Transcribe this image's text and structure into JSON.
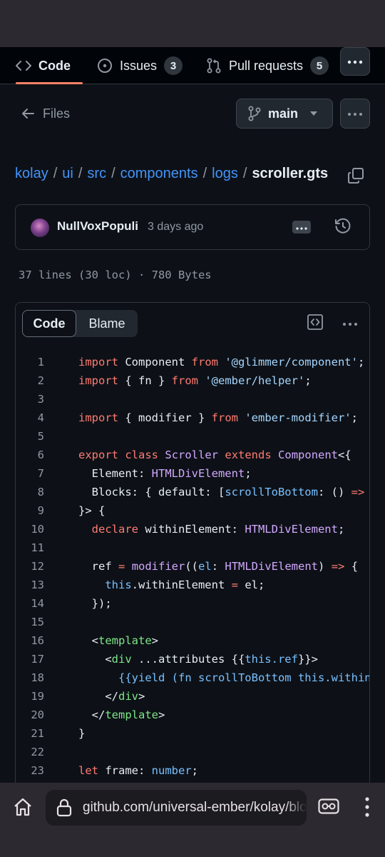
{
  "repo_tabs": {
    "code_label": "Code",
    "issues_label": "Issues",
    "issues_count": "3",
    "pulls_label": "Pull requests",
    "pulls_count": "5"
  },
  "nav": {
    "files_label": "Files",
    "branch": "main"
  },
  "breadcrumb": {
    "parts": [
      "kolay",
      "ui",
      "src",
      "components",
      "logs"
    ],
    "separator": "/",
    "current": "scroller.gts"
  },
  "commit": {
    "author": "NullVoxPopuli",
    "time": "3 days ago"
  },
  "file_stats": "37 lines (30 loc) · 780 Bytes",
  "code_view": {
    "code_tab": "Code",
    "blame_tab": "Blame"
  },
  "code": {
    "line_numbers": [
      "1",
      "2",
      "3",
      "4",
      "5",
      "6",
      "7",
      "8",
      "9",
      "10",
      "11",
      "12",
      "13",
      "14",
      "15",
      "16",
      "17",
      "18",
      "19",
      "20",
      "21",
      "22",
      "23"
    ],
    "lines": [
      [
        [
          "kw",
          "import"
        ],
        [
          "p",
          " Component "
        ],
        [
          "kw",
          "from"
        ],
        [
          "p",
          " "
        ],
        [
          "str",
          "'@glimmer/component'"
        ],
        [
          "p",
          ";"
        ]
      ],
      [
        [
          "kw",
          "import"
        ],
        [
          "p",
          " { fn } "
        ],
        [
          "kw",
          "from"
        ],
        [
          "p",
          " "
        ],
        [
          "str",
          "'@ember/helper'"
        ],
        [
          "p",
          ";"
        ]
      ],
      [],
      [
        [
          "kw",
          "import"
        ],
        [
          "p",
          " { modifier } "
        ],
        [
          "kw",
          "from"
        ],
        [
          "p",
          " "
        ],
        [
          "str",
          "'ember-modifier'"
        ],
        [
          "p",
          ";"
        ]
      ],
      [],
      [
        [
          "kw",
          "export"
        ],
        [
          "p",
          " "
        ],
        [
          "kw",
          "class"
        ],
        [
          "p",
          " "
        ],
        [
          "ty",
          "Scroller"
        ],
        [
          "p",
          " "
        ],
        [
          "kw",
          "extends"
        ],
        [
          "p",
          " "
        ],
        [
          "ty",
          "Component"
        ],
        [
          "p",
          "<{"
        ]
      ],
      [
        [
          "p",
          "  Element: "
        ],
        [
          "ty",
          "HTMLDivElement"
        ],
        [
          "p",
          ";"
        ]
      ],
      [
        [
          "p",
          "  Blocks: { default: ["
        ],
        [
          "prop",
          "scrollToBottom"
        ],
        [
          "p",
          ": () "
        ],
        [
          "kw",
          "=>"
        ]
      ],
      [
        [
          "p",
          "}> {"
        ]
      ],
      [
        [
          "p",
          "  "
        ],
        [
          "kw",
          "declare"
        ],
        [
          "p",
          " withinElement: "
        ],
        [
          "ty",
          "HTMLDivElement"
        ],
        [
          "p",
          ";"
        ]
      ],
      [],
      [
        [
          "p",
          "  ref "
        ],
        [
          "kw",
          "="
        ],
        [
          "p",
          " "
        ],
        [
          "ty",
          "modifier"
        ],
        [
          "p",
          "(("
        ],
        [
          "prop",
          "el"
        ],
        [
          "p",
          ": "
        ],
        [
          "ty",
          "HTMLDivElement"
        ],
        [
          "p",
          ") "
        ],
        [
          "kw",
          "=>"
        ],
        [
          "p",
          " {"
        ]
      ],
      [
        [
          "p",
          "    "
        ],
        [
          "prop",
          "this"
        ],
        [
          "p",
          ".withinElement "
        ],
        [
          "kw",
          "="
        ],
        [
          "p",
          " el;"
        ]
      ],
      [
        [
          "p",
          "  });"
        ]
      ],
      [],
      [
        [
          "p",
          "  <"
        ],
        [
          "tag",
          "template"
        ],
        [
          "p",
          ">"
        ]
      ],
      [
        [
          "p",
          "    <"
        ],
        [
          "tag",
          "div"
        ],
        [
          "p",
          " ...attributes {{"
        ],
        [
          "prop",
          "this.ref"
        ],
        [
          "p",
          "}}>"
        ]
      ],
      [
        [
          "p",
          "      "
        ],
        [
          "prop",
          "{{yield (fn scrollToBottom this.within"
        ]
      ],
      [
        [
          "p",
          "    </"
        ],
        [
          "tag",
          "div"
        ],
        [
          "p",
          ">"
        ]
      ],
      [
        [
          "p",
          "  </"
        ],
        [
          "tag",
          "template"
        ],
        [
          "p",
          ">"
        ]
      ],
      [
        [
          "p",
          "}"
        ]
      ],
      [],
      [
        [
          "kw",
          "let"
        ],
        [
          "p",
          " frame: "
        ],
        [
          "prop",
          "number"
        ],
        [
          "p",
          ";"
        ]
      ]
    ]
  },
  "browser": {
    "url": "github.com/universal-ember/kolay/blob/main/ui/src/components/logs/scroller.gts"
  },
  "colors": {
    "accent_link": "#4493f8",
    "tab_underline": "#f78166",
    "keyword": "#ff7b72",
    "string": "#a5d6ff",
    "type": "#d2a8ff",
    "tag": "#7ee787",
    "constant": "#79c0ff"
  },
  "icons": [
    "code-icon",
    "issues-icon",
    "pull-request-icon",
    "kebab-icon",
    "arrow-left-icon",
    "git-branch-icon",
    "caret-down-icon",
    "copy-icon",
    "avatar",
    "history-icon",
    "raw-code-icon",
    "home-icon",
    "lock-icon",
    "reader-icon",
    "menu-icon"
  ]
}
